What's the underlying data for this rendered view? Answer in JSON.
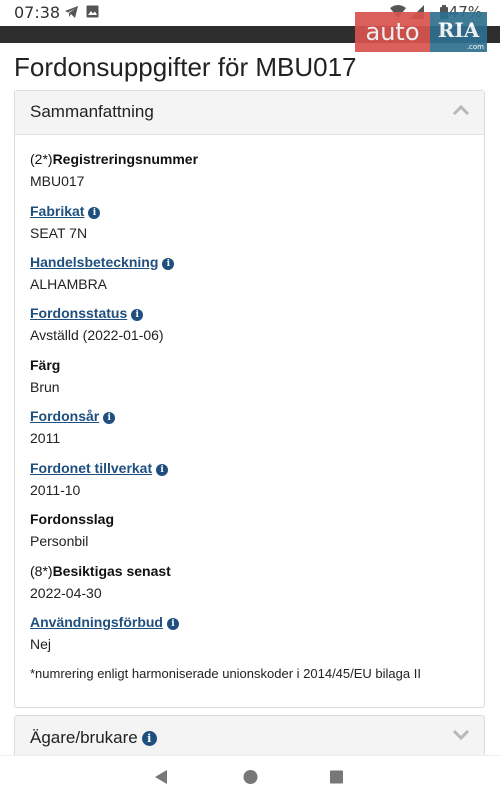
{
  "status_bar": {
    "time": "07:38",
    "battery": "47%",
    "icons": [
      "telegram-icon",
      "image-icon",
      "wifi-icon",
      "signal-icon",
      "battery-icon"
    ]
  },
  "watermark": {
    "auto": "auto",
    "ria": "RIA",
    "domain": ".com"
  },
  "page": {
    "title": "Fordonsuppgifter för MBU017"
  },
  "summary": {
    "title": "Sammanfattning",
    "fields": [
      {
        "prefix": "(2*)",
        "label": "Registreringsnummer",
        "value": "MBU017",
        "link": false,
        "info": false
      },
      {
        "prefix": "",
        "label": "Fabrikat",
        "value": "SEAT 7N",
        "link": true,
        "info": true
      },
      {
        "prefix": "",
        "label": "Handelsbeteckning",
        "value": "ALHAMBRA",
        "link": true,
        "info": true
      },
      {
        "prefix": "",
        "label": "Fordonsstatus",
        "value": "Avställd (2022-01-06)",
        "link": true,
        "info": true
      },
      {
        "prefix": "",
        "label": "Färg",
        "value": "Brun",
        "link": false,
        "info": false
      },
      {
        "prefix": "",
        "label": "Fordonsår",
        "value": "2011",
        "link": true,
        "info": true
      },
      {
        "prefix": "",
        "label": "Fordonet tillverkat",
        "value": "2011-10",
        "link": true,
        "info": true
      },
      {
        "prefix": "",
        "label": "Fordonsslag",
        "value": "Personbil",
        "link": false,
        "info": false
      },
      {
        "prefix": "(8*)",
        "label": "Besiktigas senast",
        "value": "2022-04-30",
        "link": false,
        "info": false
      },
      {
        "prefix": "",
        "label": "Användningsförbud",
        "value": "Nej",
        "link": true,
        "info": true
      }
    ],
    "footnote": "*numrering enligt harmoniserade unionskoder i 2014/45/EU bilaga II"
  },
  "owner_section": {
    "title": "Ägare/brukare"
  },
  "colors": {
    "link": "#1f4f7e",
    "card_header": "#f4f4f4"
  }
}
